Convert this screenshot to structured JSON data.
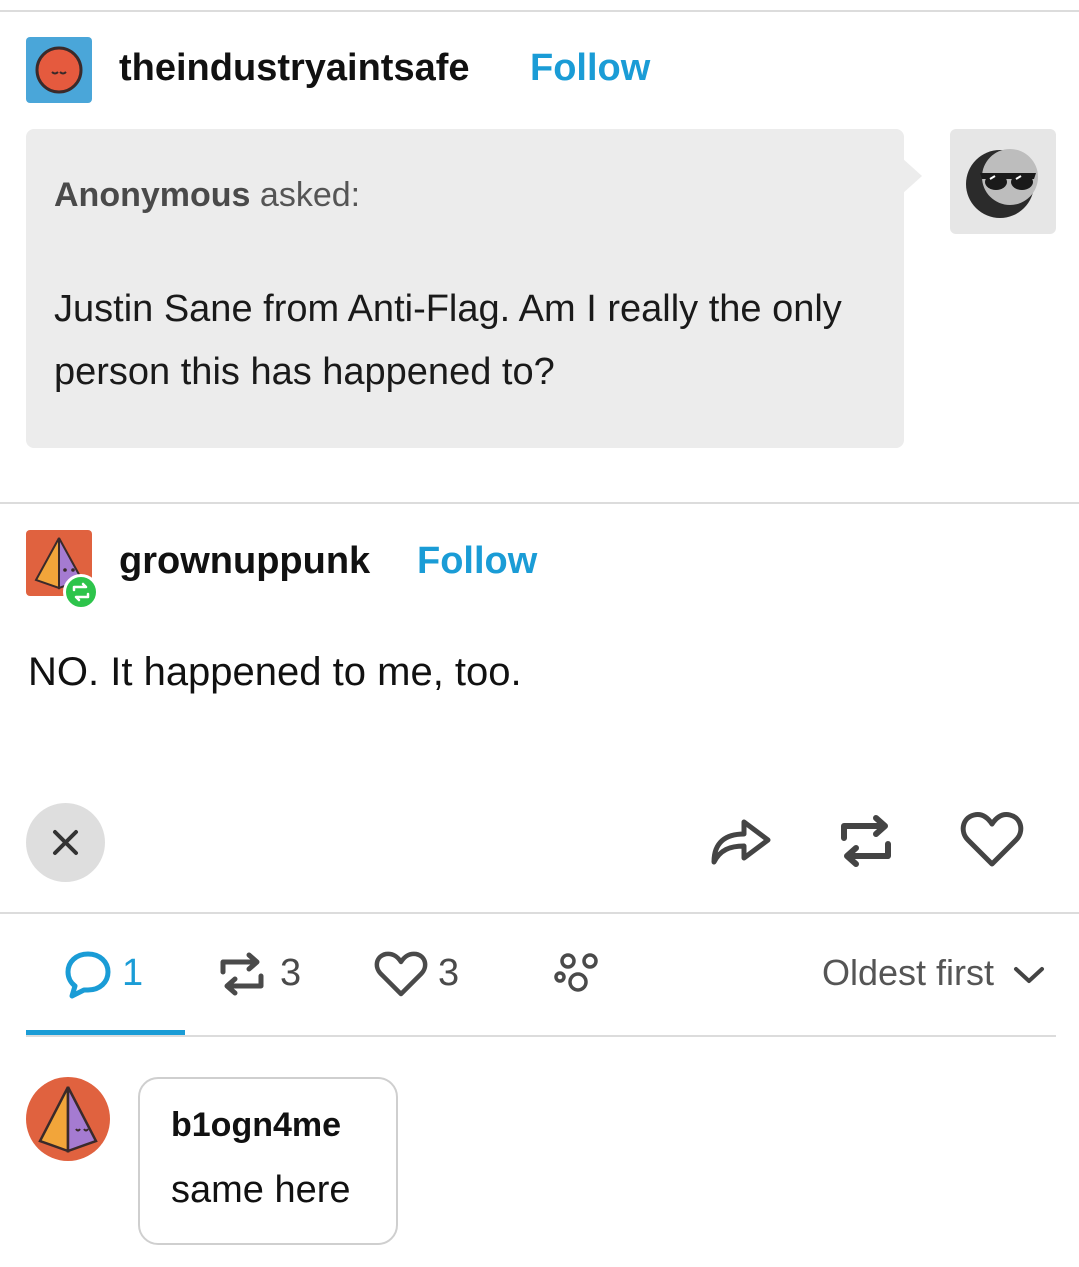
{
  "post": {
    "reblogger": {
      "username": "theindustryaintsafe",
      "follow_label": "Follow"
    },
    "ask": {
      "asker": "Anonymous",
      "asked_label": "asked:",
      "question": "Justin Sane from Anti-Flag. Am I really the only person this has happened to?"
    },
    "answerer": {
      "username": "grownuppunk",
      "follow_label": "Follow"
    },
    "answer": "NO. It happened to me, too."
  },
  "notes": {
    "replies_count": "1",
    "reblogs_count": "3",
    "likes_count": "3",
    "sort_label": "Oldest first",
    "active_tab": "replies"
  },
  "comments": [
    {
      "username": "b1ogn4me",
      "text": "same here"
    }
  ],
  "colors": {
    "accent": "#1a9cd6",
    "reblog_badge": "#2dc44b",
    "ask_background": "#ececec"
  },
  "icons": {
    "close": "close-icon",
    "share": "share-icon",
    "reblog": "reblog-icon",
    "like": "heart-icon",
    "reply": "speech-bubble-icon",
    "community": "dots-icon",
    "sort": "chevron-down-icon"
  }
}
